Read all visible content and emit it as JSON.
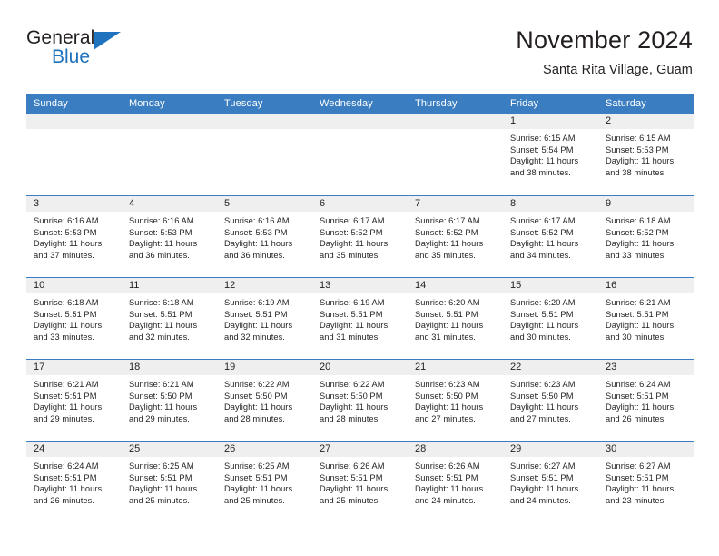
{
  "logo": {
    "word1": "General",
    "word2": "Blue",
    "triangle_color": "#1f72bd",
    "icon": "triangle-icon"
  },
  "header": {
    "title": "November 2024",
    "subtitle": "Santa Rita Village, Guam"
  },
  "theme": {
    "header_blue": "#3a7dc0",
    "daynum_gray": "#efefef",
    "text": "#231f20"
  },
  "calendar": {
    "day_headers": [
      "Sunday",
      "Monday",
      "Tuesday",
      "Wednesday",
      "Thursday",
      "Friday",
      "Saturday"
    ],
    "weeks": [
      [
        {
          "day": "",
          "lines": []
        },
        {
          "day": "",
          "lines": []
        },
        {
          "day": "",
          "lines": []
        },
        {
          "day": "",
          "lines": []
        },
        {
          "day": "",
          "lines": []
        },
        {
          "day": "1",
          "lines": [
            "Sunrise: 6:15 AM",
            "Sunset: 5:54 PM",
            "Daylight: 11 hours",
            "and 38 minutes."
          ]
        },
        {
          "day": "2",
          "lines": [
            "Sunrise: 6:15 AM",
            "Sunset: 5:53 PM",
            "Daylight: 11 hours",
            "and 38 minutes."
          ]
        }
      ],
      [
        {
          "day": "3",
          "lines": [
            "Sunrise: 6:16 AM",
            "Sunset: 5:53 PM",
            "Daylight: 11 hours",
            "and 37 minutes."
          ]
        },
        {
          "day": "4",
          "lines": [
            "Sunrise: 6:16 AM",
            "Sunset: 5:53 PM",
            "Daylight: 11 hours",
            "and 36 minutes."
          ]
        },
        {
          "day": "5",
          "lines": [
            "Sunrise: 6:16 AM",
            "Sunset: 5:53 PM",
            "Daylight: 11 hours",
            "and 36 minutes."
          ]
        },
        {
          "day": "6",
          "lines": [
            "Sunrise: 6:17 AM",
            "Sunset: 5:52 PM",
            "Daylight: 11 hours",
            "and 35 minutes."
          ]
        },
        {
          "day": "7",
          "lines": [
            "Sunrise: 6:17 AM",
            "Sunset: 5:52 PM",
            "Daylight: 11 hours",
            "and 35 minutes."
          ]
        },
        {
          "day": "8",
          "lines": [
            "Sunrise: 6:17 AM",
            "Sunset: 5:52 PM",
            "Daylight: 11 hours",
            "and 34 minutes."
          ]
        },
        {
          "day": "9",
          "lines": [
            "Sunrise: 6:18 AM",
            "Sunset: 5:52 PM",
            "Daylight: 11 hours",
            "and 33 minutes."
          ]
        }
      ],
      [
        {
          "day": "10",
          "lines": [
            "Sunrise: 6:18 AM",
            "Sunset: 5:51 PM",
            "Daylight: 11 hours",
            "and 33 minutes."
          ]
        },
        {
          "day": "11",
          "lines": [
            "Sunrise: 6:18 AM",
            "Sunset: 5:51 PM",
            "Daylight: 11 hours",
            "and 32 minutes."
          ]
        },
        {
          "day": "12",
          "lines": [
            "Sunrise: 6:19 AM",
            "Sunset: 5:51 PM",
            "Daylight: 11 hours",
            "and 32 minutes."
          ]
        },
        {
          "day": "13",
          "lines": [
            "Sunrise: 6:19 AM",
            "Sunset: 5:51 PM",
            "Daylight: 11 hours",
            "and 31 minutes."
          ]
        },
        {
          "day": "14",
          "lines": [
            "Sunrise: 6:20 AM",
            "Sunset: 5:51 PM",
            "Daylight: 11 hours",
            "and 31 minutes."
          ]
        },
        {
          "day": "15",
          "lines": [
            "Sunrise: 6:20 AM",
            "Sunset: 5:51 PM",
            "Daylight: 11 hours",
            "and 30 minutes."
          ]
        },
        {
          "day": "16",
          "lines": [
            "Sunrise: 6:21 AM",
            "Sunset: 5:51 PM",
            "Daylight: 11 hours",
            "and 30 minutes."
          ]
        }
      ],
      [
        {
          "day": "17",
          "lines": [
            "Sunrise: 6:21 AM",
            "Sunset: 5:51 PM",
            "Daylight: 11 hours",
            "and 29 minutes."
          ]
        },
        {
          "day": "18",
          "lines": [
            "Sunrise: 6:21 AM",
            "Sunset: 5:50 PM",
            "Daylight: 11 hours",
            "and 29 minutes."
          ]
        },
        {
          "day": "19",
          "lines": [
            "Sunrise: 6:22 AM",
            "Sunset: 5:50 PM",
            "Daylight: 11 hours",
            "and 28 minutes."
          ]
        },
        {
          "day": "20",
          "lines": [
            "Sunrise: 6:22 AM",
            "Sunset: 5:50 PM",
            "Daylight: 11 hours",
            "and 28 minutes."
          ]
        },
        {
          "day": "21",
          "lines": [
            "Sunrise: 6:23 AM",
            "Sunset: 5:50 PM",
            "Daylight: 11 hours",
            "and 27 minutes."
          ]
        },
        {
          "day": "22",
          "lines": [
            "Sunrise: 6:23 AM",
            "Sunset: 5:50 PM",
            "Daylight: 11 hours",
            "and 27 minutes."
          ]
        },
        {
          "day": "23",
          "lines": [
            "Sunrise: 6:24 AM",
            "Sunset: 5:51 PM",
            "Daylight: 11 hours",
            "and 26 minutes."
          ]
        }
      ],
      [
        {
          "day": "24",
          "lines": [
            "Sunrise: 6:24 AM",
            "Sunset: 5:51 PM",
            "Daylight: 11 hours",
            "and 26 minutes."
          ]
        },
        {
          "day": "25",
          "lines": [
            "Sunrise: 6:25 AM",
            "Sunset: 5:51 PM",
            "Daylight: 11 hours",
            "and 25 minutes."
          ]
        },
        {
          "day": "26",
          "lines": [
            "Sunrise: 6:25 AM",
            "Sunset: 5:51 PM",
            "Daylight: 11 hours",
            "and 25 minutes."
          ]
        },
        {
          "day": "27",
          "lines": [
            "Sunrise: 6:26 AM",
            "Sunset: 5:51 PM",
            "Daylight: 11 hours",
            "and 25 minutes."
          ]
        },
        {
          "day": "28",
          "lines": [
            "Sunrise: 6:26 AM",
            "Sunset: 5:51 PM",
            "Daylight: 11 hours",
            "and 24 minutes."
          ]
        },
        {
          "day": "29",
          "lines": [
            "Sunrise: 6:27 AM",
            "Sunset: 5:51 PM",
            "Daylight: 11 hours",
            "and 24 minutes."
          ]
        },
        {
          "day": "30",
          "lines": [
            "Sunrise: 6:27 AM",
            "Sunset: 5:51 PM",
            "Daylight: 11 hours",
            "and 23 minutes."
          ]
        }
      ]
    ]
  }
}
